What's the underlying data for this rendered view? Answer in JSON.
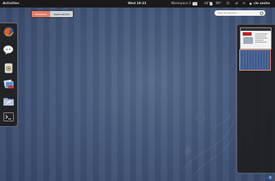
{
  "topbar": {
    "activities_label": "Activities",
    "clock": "Wed 19:21",
    "workspace_label": "Workspace 2",
    "temp_1": "24°",
    "temp_2": "90°",
    "user_name": "cle seshe"
  },
  "view_tabs": [
    {
      "label": "Windows",
      "active": true
    },
    {
      "label": "Applications",
      "active": false
    }
  ],
  "search": {
    "placeholder": "Type to search..."
  },
  "dash": {
    "items": [
      {
        "name": "firefox-icon"
      },
      {
        "name": "empathy-icon"
      },
      {
        "name": "rhythmbox-icon"
      },
      {
        "name": "shotwell-icon"
      },
      {
        "name": "files-icon"
      },
      {
        "name": "terminal-icon"
      }
    ]
  },
  "workspaces": {
    "count": 2,
    "active_index": 1
  },
  "colors": {
    "topbar": "#1a1a1a",
    "accent": "#e07b62",
    "desktop": "#45587a"
  }
}
